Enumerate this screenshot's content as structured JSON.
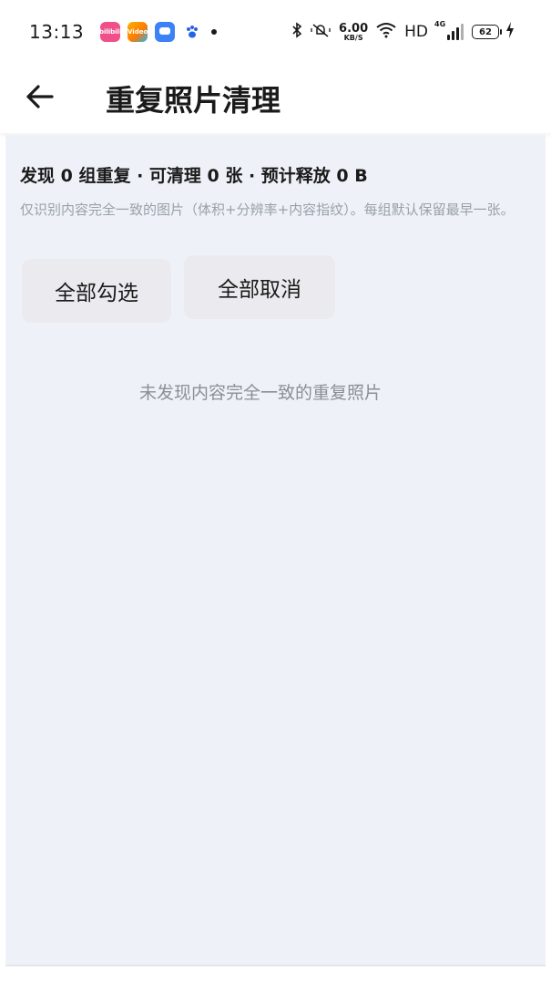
{
  "status_bar": {
    "time": "13:13",
    "apps": [
      {
        "icon": "bilibili-app-icon",
        "label": "bilibili"
      },
      {
        "icon": "video-app-icon",
        "label": "Video"
      },
      {
        "icon": "chat-app-icon",
        "label": ""
      },
      {
        "icon": "baidu-paw-icon",
        "label": ""
      }
    ],
    "net_speed_value": "6.00",
    "net_speed_unit": "KB/S",
    "hd": "HD",
    "network": "4G",
    "battery": "62",
    "icons": [
      "bluetooth-icon",
      "mute-vibrate-icon",
      "wifi-icon",
      "signal-icon",
      "battery-icon",
      "charging-icon"
    ]
  },
  "header": {
    "title": "重复照片清理",
    "back_icon": "arrow-left-icon"
  },
  "main": {
    "summary": "发现 0 组重复 · 可清理 0 张 · 预计释放 0 B",
    "hint": "仅识别内容完全一致的图片（体积+分辨率+内容指纹）。每组默认保留最早一张。",
    "select_all_label": "全部勾选",
    "deselect_all_label": "全部取消",
    "empty_message": "未发现内容完全一致的重复照片"
  },
  "colors": {
    "content_bg": "#eef2f8",
    "button_bg": "#ebebef",
    "hint_text": "#9aa0a8",
    "empty_text": "#8a8f96"
  }
}
